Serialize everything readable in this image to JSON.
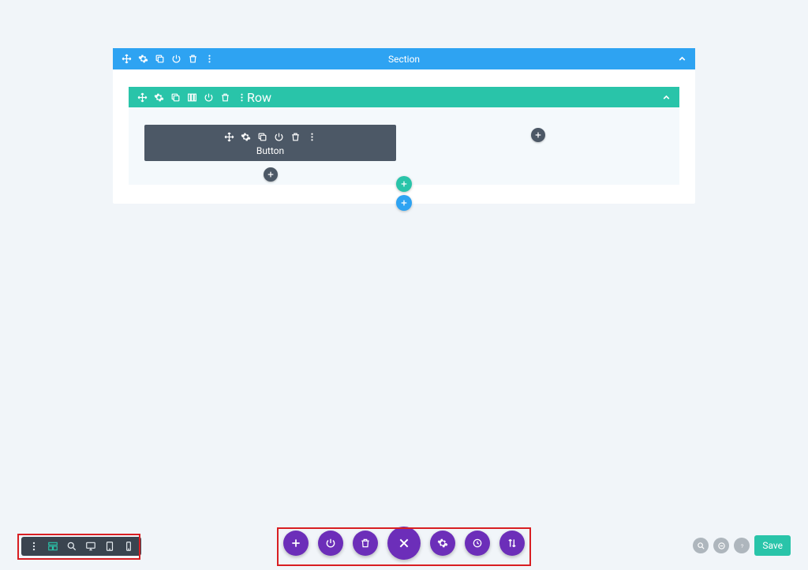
{
  "section": {
    "label": "Section",
    "row": {
      "label": "Row",
      "module": {
        "label": "Button"
      }
    }
  },
  "bottom_right": {
    "save_label": "Save"
  },
  "colors": {
    "section_bar": "#2ea3f2",
    "row_bar": "#29c4a9",
    "module_bar": "#4c5866",
    "action_purple": "#6c2eb9",
    "highlight_red": "#d81e22"
  }
}
